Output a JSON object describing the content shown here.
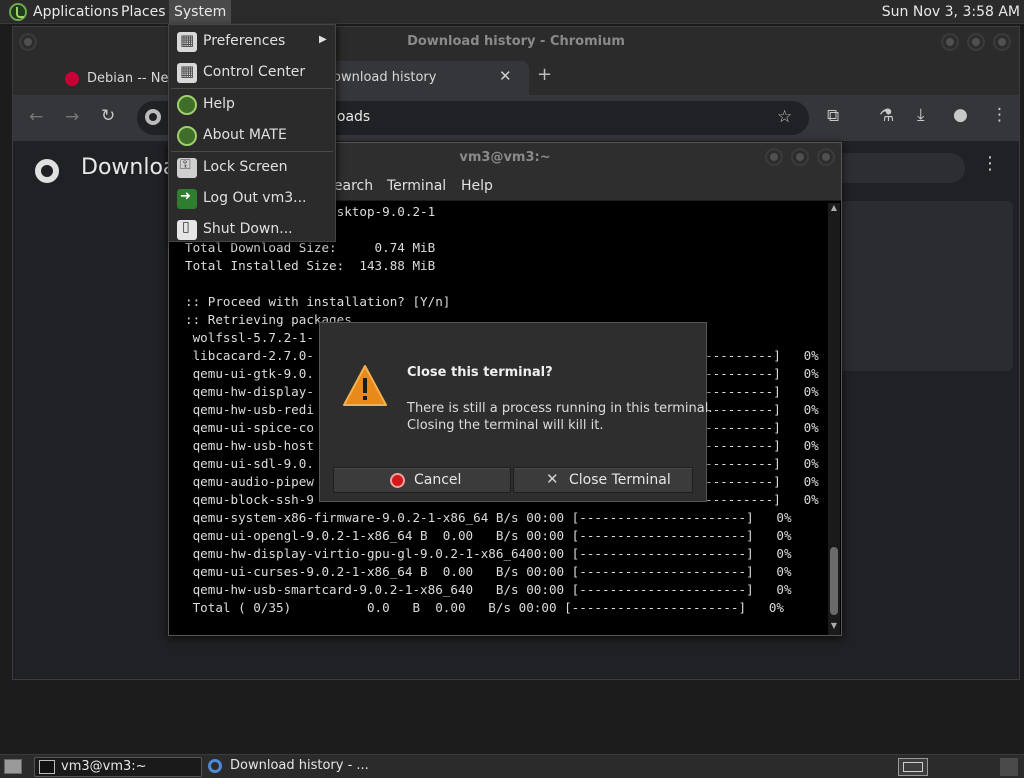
{
  "top_panel": {
    "menus": [
      "Applications",
      "Places",
      "System"
    ],
    "clock": "Sun Nov 3,  3:58 AM"
  },
  "chromium": {
    "window_title": "Download history - Chromium",
    "tabs": [
      {
        "label": "Debian -- Netw",
        "icon": "debian-icon"
      },
      {
        "label": "Download history",
        "icon": "chrome-icon"
      }
    ],
    "omnibox_text": "loads",
    "page_title": "Downloa",
    "page_partial_text": "T"
  },
  "terminal": {
    "title": "vm3@vm3:~",
    "menus": [
      "Search",
      "Terminal",
      "Help"
    ],
    "lines": [
      "ssl-5.7.2-1  qemu-desktop-9.0.2-1",
      "Total Download Size:     0.74 MiB",
      "Total Installed Size:  143.88 MiB",
      "",
      ":: Proceed with installation? [Y/n]",
      ":: Retrieving packages...",
      " wolfssl-5.7.2-1-",
      " libcacard-2.7.0-",
      " qemu-ui-gtk-9.0.",
      " qemu-hw-display-",
      " qemu-hw-usb-redi",
      " qemu-ui-spice-co",
      " qemu-hw-usb-host",
      " qemu-ui-sdl-9.0.",
      " qemu-audio-pipew",
      " qemu-block-ssh-9",
      " qemu-system-x86-firmware-9.0.2-1-x86_64 B/s 00:00 [----------------------]   0%",
      " qemu-ui-opengl-9.0.2-1-x86_64 B  0.00   B/s 00:00 [----------------------]   0%",
      " qemu-hw-display-virtio-gpu-gl-9.0.2-1-x86_6400:00 [----------------------]   0%",
      " qemu-ui-curses-9.0.2-1-x86_64 B  0.00   B/s 00:00 [----------------------]   0%",
      " qemu-hw-usb-smartcard-9.0.2-1-x86_640   B/s 00:00 [----------------------]   0%",
      " Total ( 0/35)          0.0   B  0.00   B/s 00:00 [----------------------]   0%"
    ],
    "right_fragments": [
      "---------]   0%",
      "---------]   0%",
      "---------]   0%",
      "---------]   0%",
      "---------]   0%",
      "---------]   0%",
      "---------]   0%",
      "---------]   0%",
      "---------]   0%"
    ]
  },
  "system_menu": {
    "items": [
      {
        "label": "Preferences",
        "icon": "preferences-icon",
        "submenu": true
      },
      {
        "label": "Control Center",
        "icon": "control-center-icon"
      },
      {
        "label": "Help",
        "icon": "help-icon"
      },
      {
        "label": "About MATE",
        "icon": "mate-icon"
      },
      {
        "label": "Lock Screen",
        "icon": "lock-icon"
      },
      {
        "label": "Log Out vm3...",
        "icon": "logout-icon"
      },
      {
        "label": "Shut Down...",
        "icon": "shutdown-icon"
      }
    ]
  },
  "dialog": {
    "heading": "Close this terminal?",
    "message_line1": "There is still a process running in this terminal.",
    "message_line2": "Closing the terminal will kill it.",
    "cancel_label": "Cancel",
    "close_label": "Close Terminal"
  },
  "taskbar": {
    "items": [
      {
        "label": "vm3@vm3:~",
        "icon": "terminal-icon"
      },
      {
        "label": "Download history - ...",
        "icon": "chromium-icon"
      }
    ]
  }
}
